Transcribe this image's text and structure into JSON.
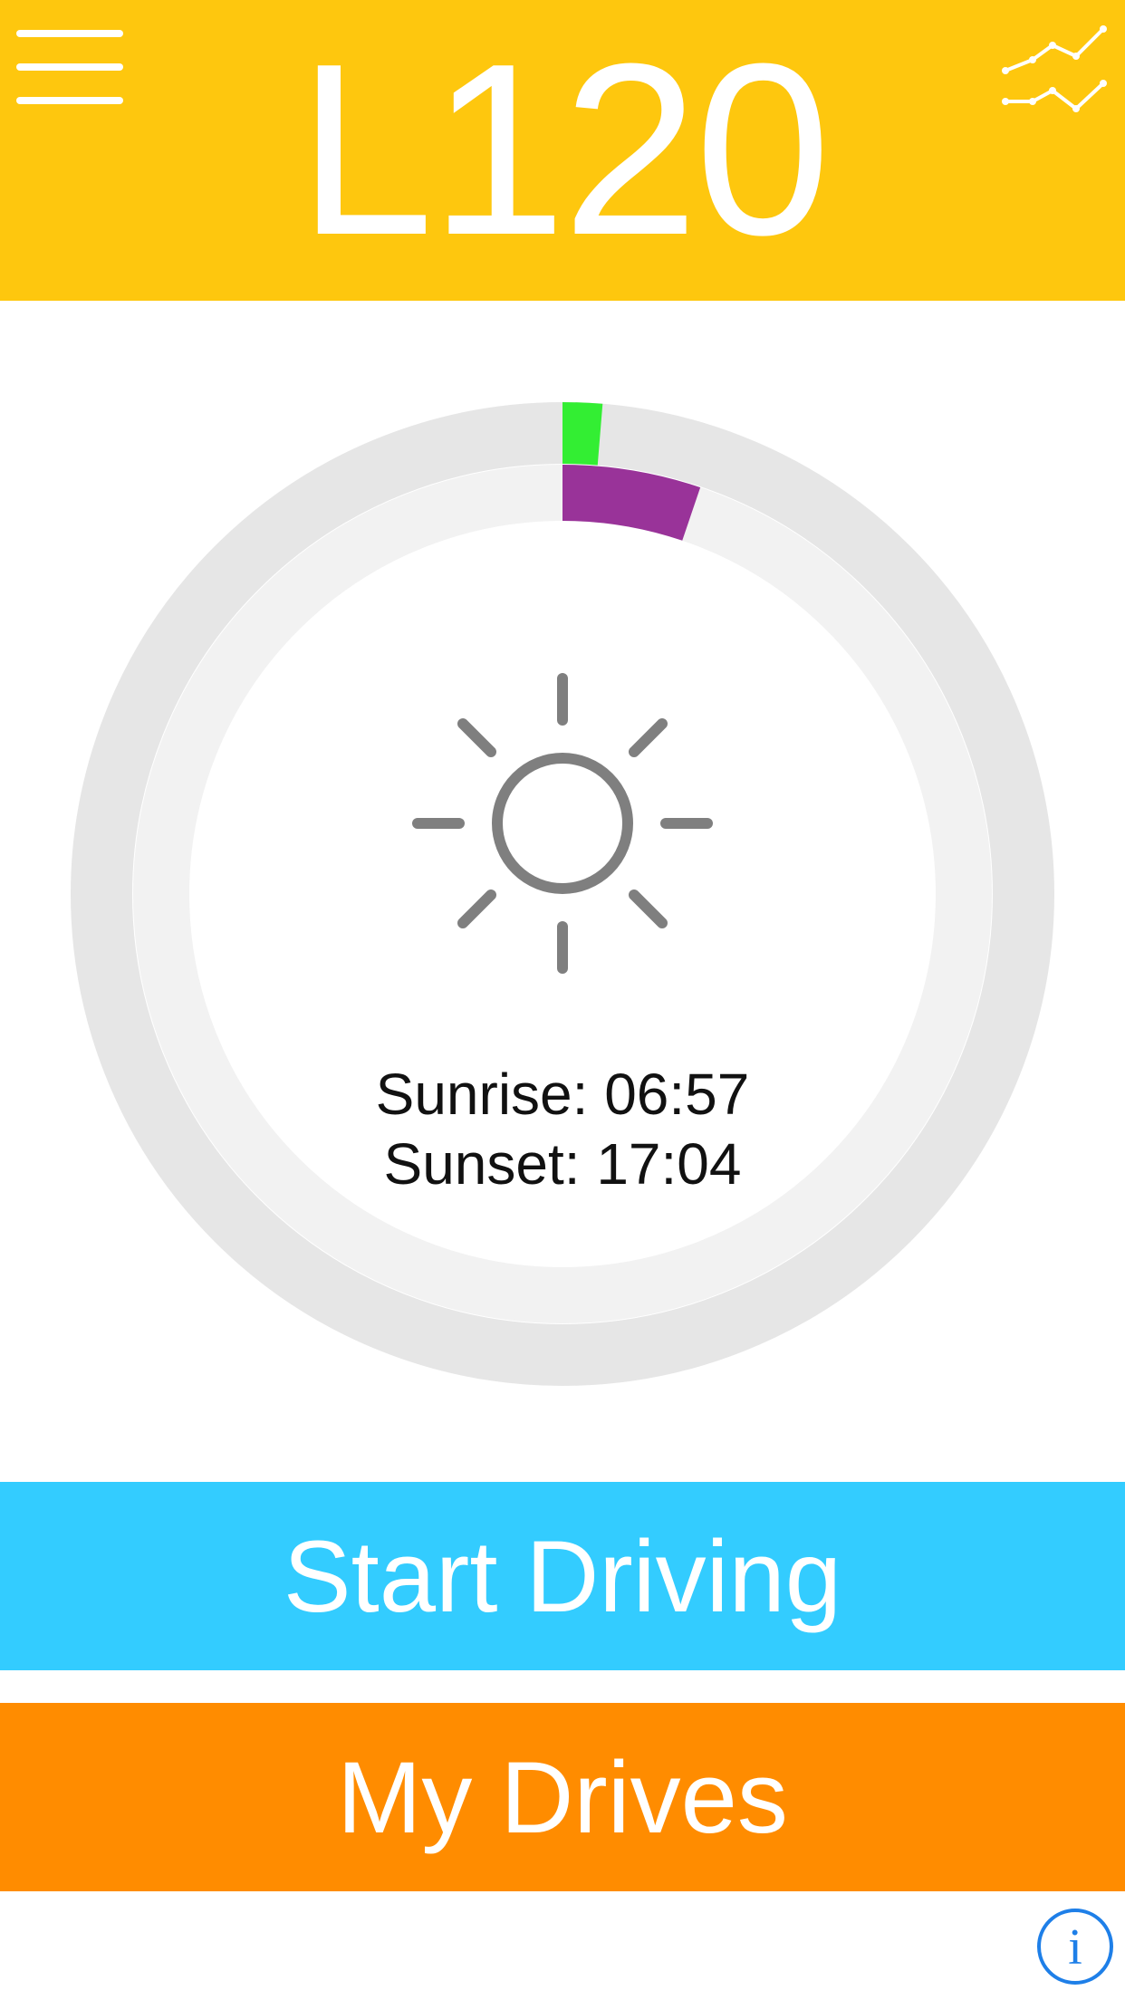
{
  "header": {
    "title": "L120",
    "background": "#FEC70E",
    "menu_icon": "hamburger-menu-icon",
    "stats_icon": "line-chart-icon"
  },
  "daylight_ring": {
    "sun_icon": "sun-icon",
    "outer_segment_color": "#33EE33",
    "outer_segment_fraction": 0.013,
    "inner_segment_color": "#993399",
    "inner_segment_fraction": 0.052,
    "track_outer_color": "#E6E6E6",
    "track_inner_color": "#F2F2F2"
  },
  "sun_times": {
    "sunrise": "Sunrise: 06:57",
    "sunset": "Sunset: 17:04"
  },
  "buttons": {
    "start_driving": {
      "label": "Start Driving",
      "color": "#33CCFF"
    },
    "my_drives": {
      "label": "My Drives",
      "color": "#FF8C00"
    }
  },
  "footer": {
    "info_icon": "info-icon",
    "info_glyph": "i",
    "info_color": "#1E7FE8"
  }
}
